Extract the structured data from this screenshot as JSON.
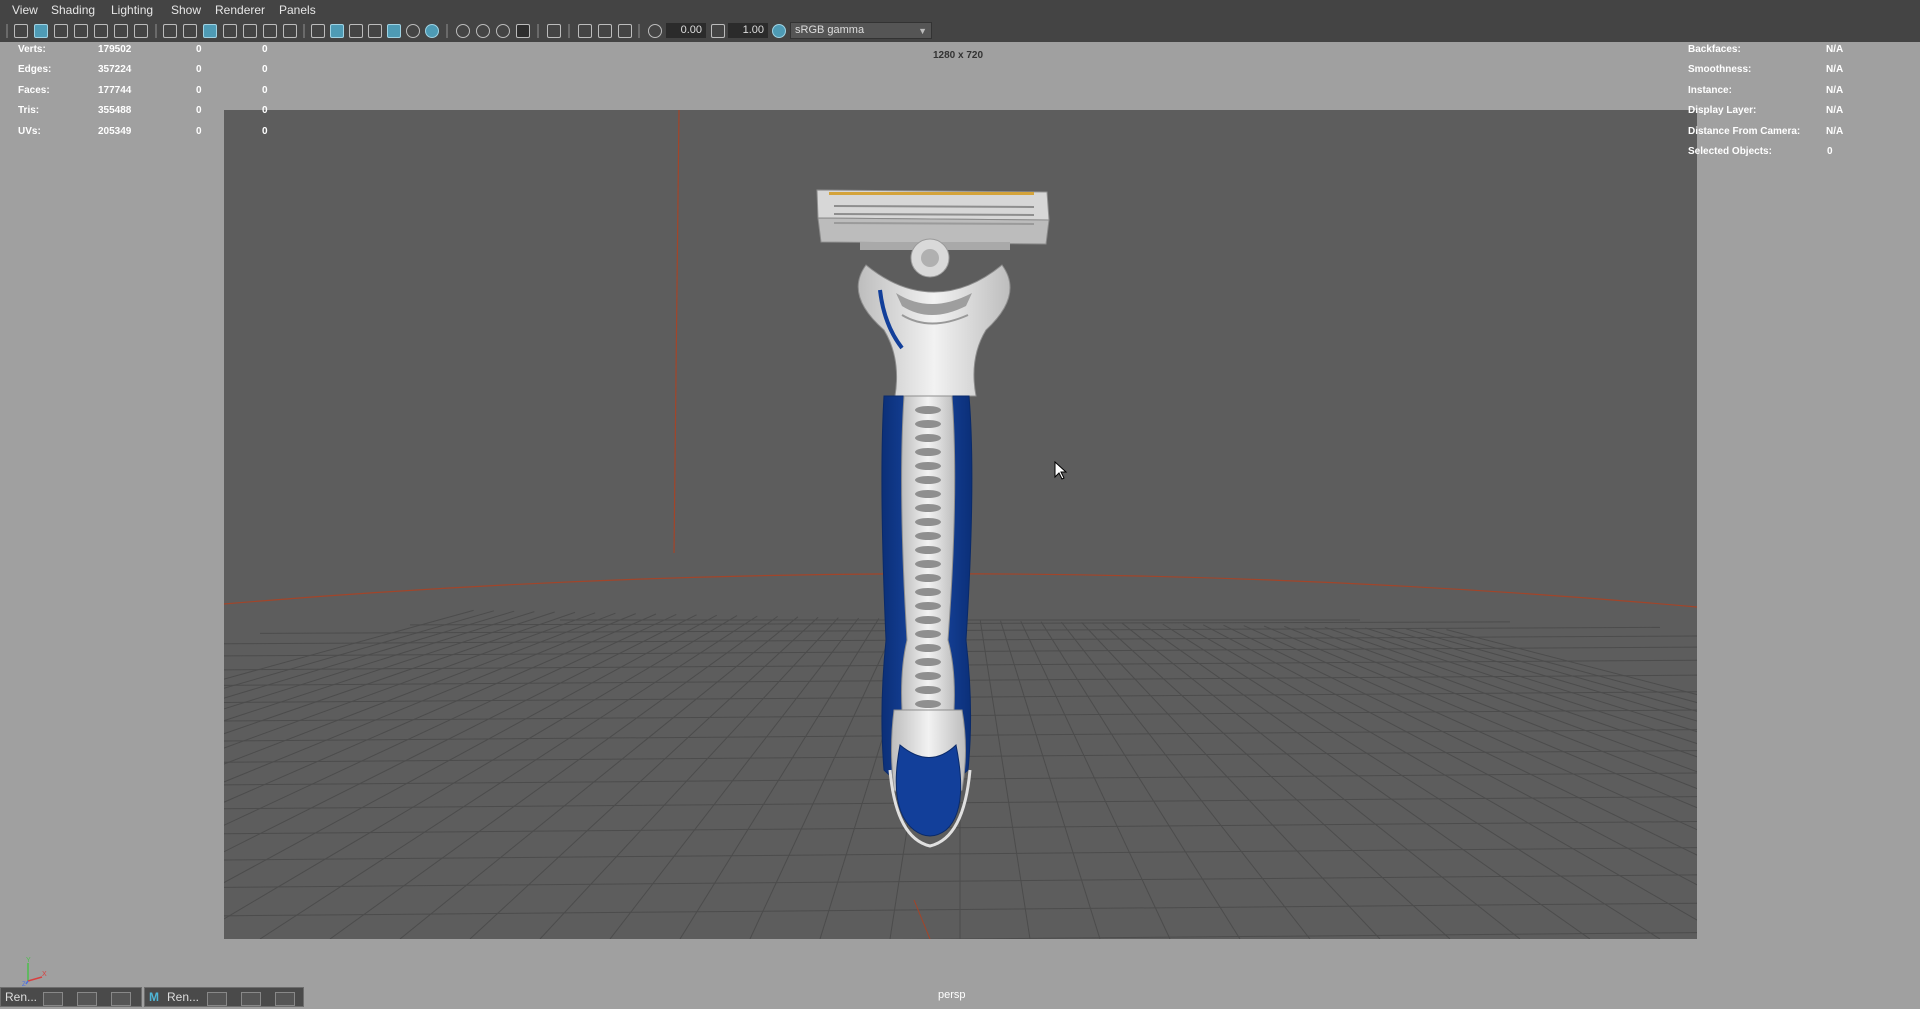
{
  "menu": [
    "View",
    "Shading",
    "Lighting",
    "Show",
    "Renderer",
    "Panels"
  ],
  "toolbar": {
    "exposure_value": "0.00",
    "gamma_value": "1.00",
    "color_space": "sRGB gamma"
  },
  "hud_left": [
    {
      "label": "Verts:",
      "value": "179502",
      "sel": "0",
      "comp": "0"
    },
    {
      "label": "Edges:",
      "value": "357224",
      "sel": "0",
      "comp": "0"
    },
    {
      "label": "Faces:",
      "value": "177744",
      "sel": "0",
      "comp": "0"
    },
    {
      "label": "Tris:",
      "value": "355488",
      "sel": "0",
      "comp": "0"
    },
    {
      "label": "UVs:",
      "value": "205349",
      "sel": "0",
      "comp": "0"
    }
  ],
  "hud_right": [
    {
      "label": "Backfaces:",
      "value": "N/A"
    },
    {
      "label": "Smoothness:",
      "value": "N/A"
    },
    {
      "label": "Instance:",
      "value": "N/A"
    },
    {
      "label": "Display Layer:",
      "value": "N/A"
    },
    {
      "label": "Distance From Camera:",
      "value": "N/A"
    },
    {
      "label": "Selected Objects:",
      "value": "0"
    }
  ],
  "resolution": "1280 x 720",
  "camera_name": "persp",
  "axis": {
    "y": "Y",
    "x": "X",
    "z": "Z"
  },
  "taskbar": [
    {
      "label": "Ren..."
    },
    {
      "label": "Ren..."
    }
  ],
  "colors": {
    "grid_line": "#4c4c4c",
    "horizon_line": "#a2452a",
    "razor_blue": "#123f9a",
    "razor_white": "#dcdcdc",
    "background": "#5d5d5d"
  }
}
